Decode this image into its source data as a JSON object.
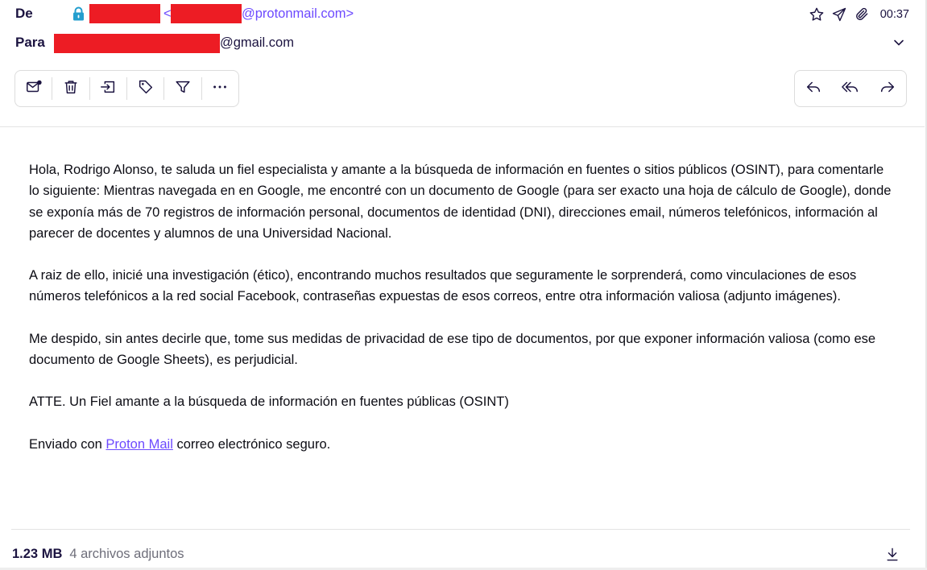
{
  "header": {
    "from_label": "De",
    "from_open_bracket": "<",
    "from_domain": "@protonmail.com>",
    "to_label": "Para",
    "to_domain": "@gmail.com",
    "time": "00:37",
    "icons": [
      "star-icon",
      "paper-plane-icon",
      "paperclip-icon",
      "chevron-down-icon",
      "lock-icon"
    ],
    "colors": {
      "accent": "#6d4aff",
      "redaction": "#ed1c24",
      "lock": "#239ece"
    }
  },
  "toolbar_left": [
    {
      "name": "mark-unread-icon"
    },
    {
      "name": "trash-icon"
    },
    {
      "name": "move-to-icon"
    },
    {
      "name": "label-tag-icon"
    },
    {
      "name": "filter-icon"
    },
    {
      "name": "more-icon"
    }
  ],
  "toolbar_right": [
    {
      "name": "reply-icon"
    },
    {
      "name": "reply-all-icon"
    },
    {
      "name": "forward-icon"
    }
  ],
  "body": {
    "p1": "Hola, Rodrigo Alonso, te saluda un fiel especialista y amante a la búsqueda de información en fuentes o sitios públicos (OSINT), para comentarle lo siguiente: Mientras navegada en en Google, me encontré con un documento de Google (para ser exacto una hoja de cálculo de Google), donde se exponía más de 70 registros de información personal, documentos de identidad (DNI), direcciones email, números telefónicos, información al parecer de docentes y alumnos de una Universidad Nacional.",
    "p2": "A raiz de ello, inicié una investigación (ético), encontrando muchos resultados que seguramente le sorprenderá, como vinculaciones de esos números telefónicos a la red social Facebook, contraseñas expuestas de esos correos, entre otra información valiosa (adjunto imágenes).",
    "p3": "Me despido, sin antes decirle que, tome sus medidas de privacidad de ese tipo de documentos, por que exponer información valiosa (como ese documento de Google Sheets), es perjudicial.",
    "p4": "ATTE. Un Fiel amante a la búsqueda de información en fuentes públicas (OSINT)",
    "sig_prefix": "Enviado con ",
    "sig_link": "Proton Mail",
    "sig_suffix": " correo electrónico seguro."
  },
  "attachments": {
    "size": "1.23 MB",
    "count": "4 archivos adjuntos"
  }
}
